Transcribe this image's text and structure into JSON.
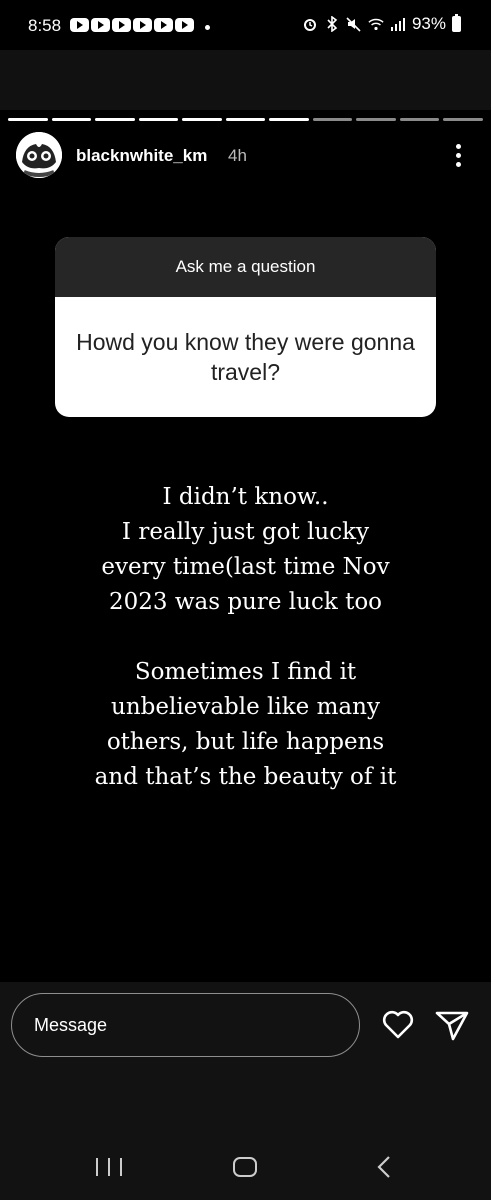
{
  "status_bar": {
    "time": "8:58",
    "notification_icons": [
      "youtube-icon",
      "youtube-icon",
      "youtube-icon",
      "youtube-icon",
      "youtube-icon",
      "youtube-icon"
    ],
    "battery": "93%"
  },
  "story": {
    "segments_total": 11,
    "segments_viewed": 7,
    "username": "blacknwhite_km",
    "time_ago": "4h",
    "question_sticker": {
      "header": "Ask me a question",
      "question": "Howd you know they were gonna travel?"
    },
    "answer_paragraphs": [
      [
        "I didn’t know..",
        "I really just got lucky",
        "every time(last time Nov",
        "2023 was pure luck too"
      ],
      [
        "Sometimes I find it",
        "unbelievable like many",
        "others, but life happens",
        "and that’s the beauty of it"
      ]
    ]
  },
  "reply_bar": {
    "placeholder": "Message"
  },
  "colors": {
    "background": "#000000",
    "sticker_header": "#262626",
    "sticker_body": "#ffffff",
    "reply_bar_bg": "#121212"
  }
}
